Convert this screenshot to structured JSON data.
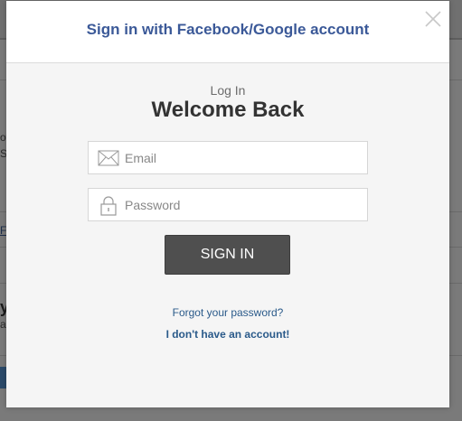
{
  "background": {
    "fragments": [
      "ot",
      "S",
      "Fa",
      "y",
      "a"
    ]
  },
  "modal": {
    "social_link": "Sign in with Facebook/Google account",
    "kicker": "Log In",
    "title": "Welcome Back",
    "email": {
      "placeholder": "Email",
      "value": ""
    },
    "password": {
      "placeholder": "Password",
      "value": ""
    },
    "signin_label": "SIGN IN",
    "forgot_label": "Forgot your password?",
    "no_account_label": "I don't have an account!"
  },
  "colors": {
    "overlay": "#7f7f7f",
    "modal_bg": "#f5f5f5",
    "social_link": "#3b5998",
    "button": "#4f4f4f",
    "link": "#2a5a8a"
  },
  "icons": {
    "close": "close-icon",
    "email": "envelope-icon",
    "password": "lock-icon"
  }
}
